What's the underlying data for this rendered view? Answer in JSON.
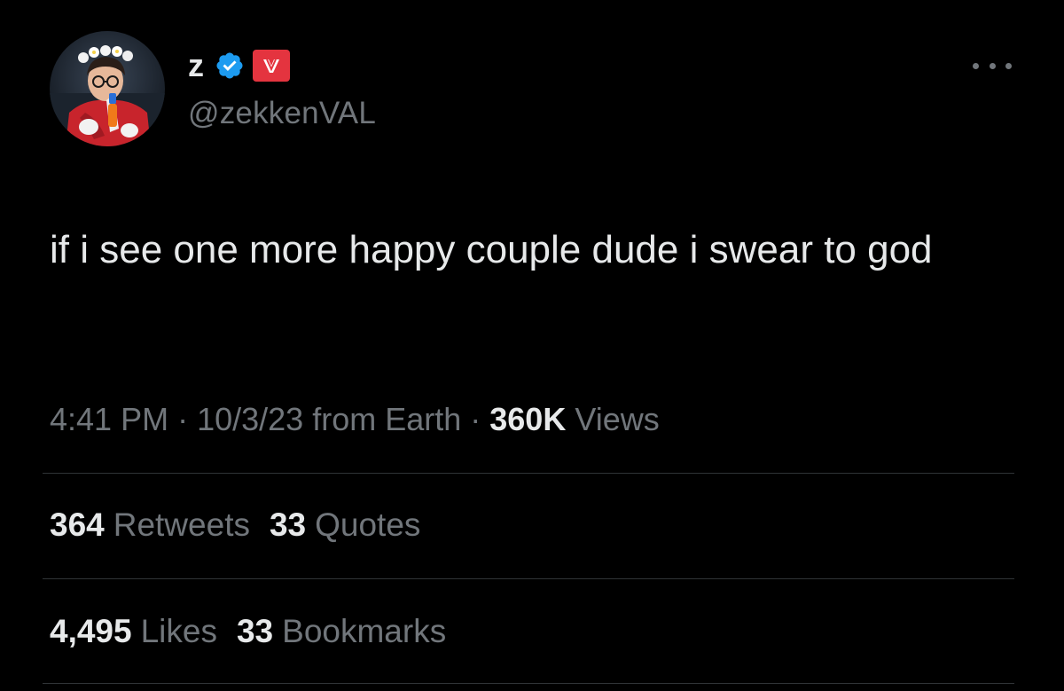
{
  "author": {
    "display_name": "z",
    "handle": "@zekkenVAL",
    "avatar_icon": "profile-photo",
    "verified_icon": "verified-badge-icon",
    "affiliate_icon": "valorant-affiliate-badge-icon"
  },
  "tweet": {
    "text": "if i see one more happy couple dude i swear to god"
  },
  "meta": {
    "time": "4:41 PM",
    "separator1": " · ",
    "date": "10/3/23",
    "source": " from Earth",
    "separator2": " · ",
    "views_count": "360K",
    "views_label": " Views"
  },
  "stats": {
    "retweets_count": "364",
    "retweets_label": "Retweets",
    "quotes_count": "33",
    "quotes_label": "Quotes",
    "likes_count": "4,495",
    "likes_label": "Likes",
    "bookmarks_count": "33",
    "bookmarks_label": "Bookmarks"
  },
  "colors": {
    "background": "#000000",
    "primary_text": "#e7e9ea",
    "secondary_text": "#71767b",
    "divider": "#2f3336",
    "verified_blue": "#1d9bf0",
    "affiliate_red": "#e4343f"
  }
}
